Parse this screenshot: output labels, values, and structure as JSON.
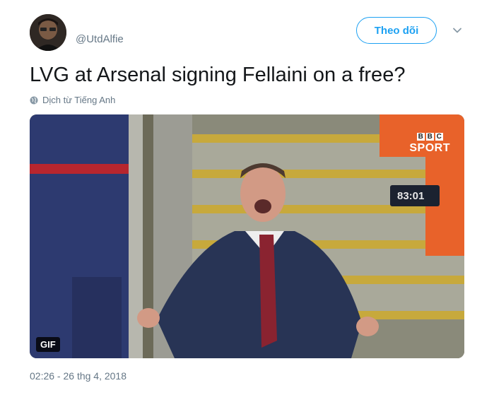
{
  "header": {
    "handle": "@UtdAlfie",
    "follow_label": "Theo dõi"
  },
  "tweet": {
    "text": "LVG at Arsenal signing Fellaini on a free?",
    "translate_label": "Dịch từ Tiếng Anh",
    "timestamp": "02:26 - 26 thg 4, 2018"
  },
  "media": {
    "badge": "GIF",
    "broadcaster_blocks": [
      "B",
      "B",
      "C"
    ],
    "broadcaster_sport": "SPORT"
  },
  "colors": {
    "accent": "#1da1f2",
    "muted_text": "#657786",
    "primary_text": "#14171a"
  },
  "icons": {
    "translate": "globe-icon",
    "menu": "chevron-down-icon"
  }
}
